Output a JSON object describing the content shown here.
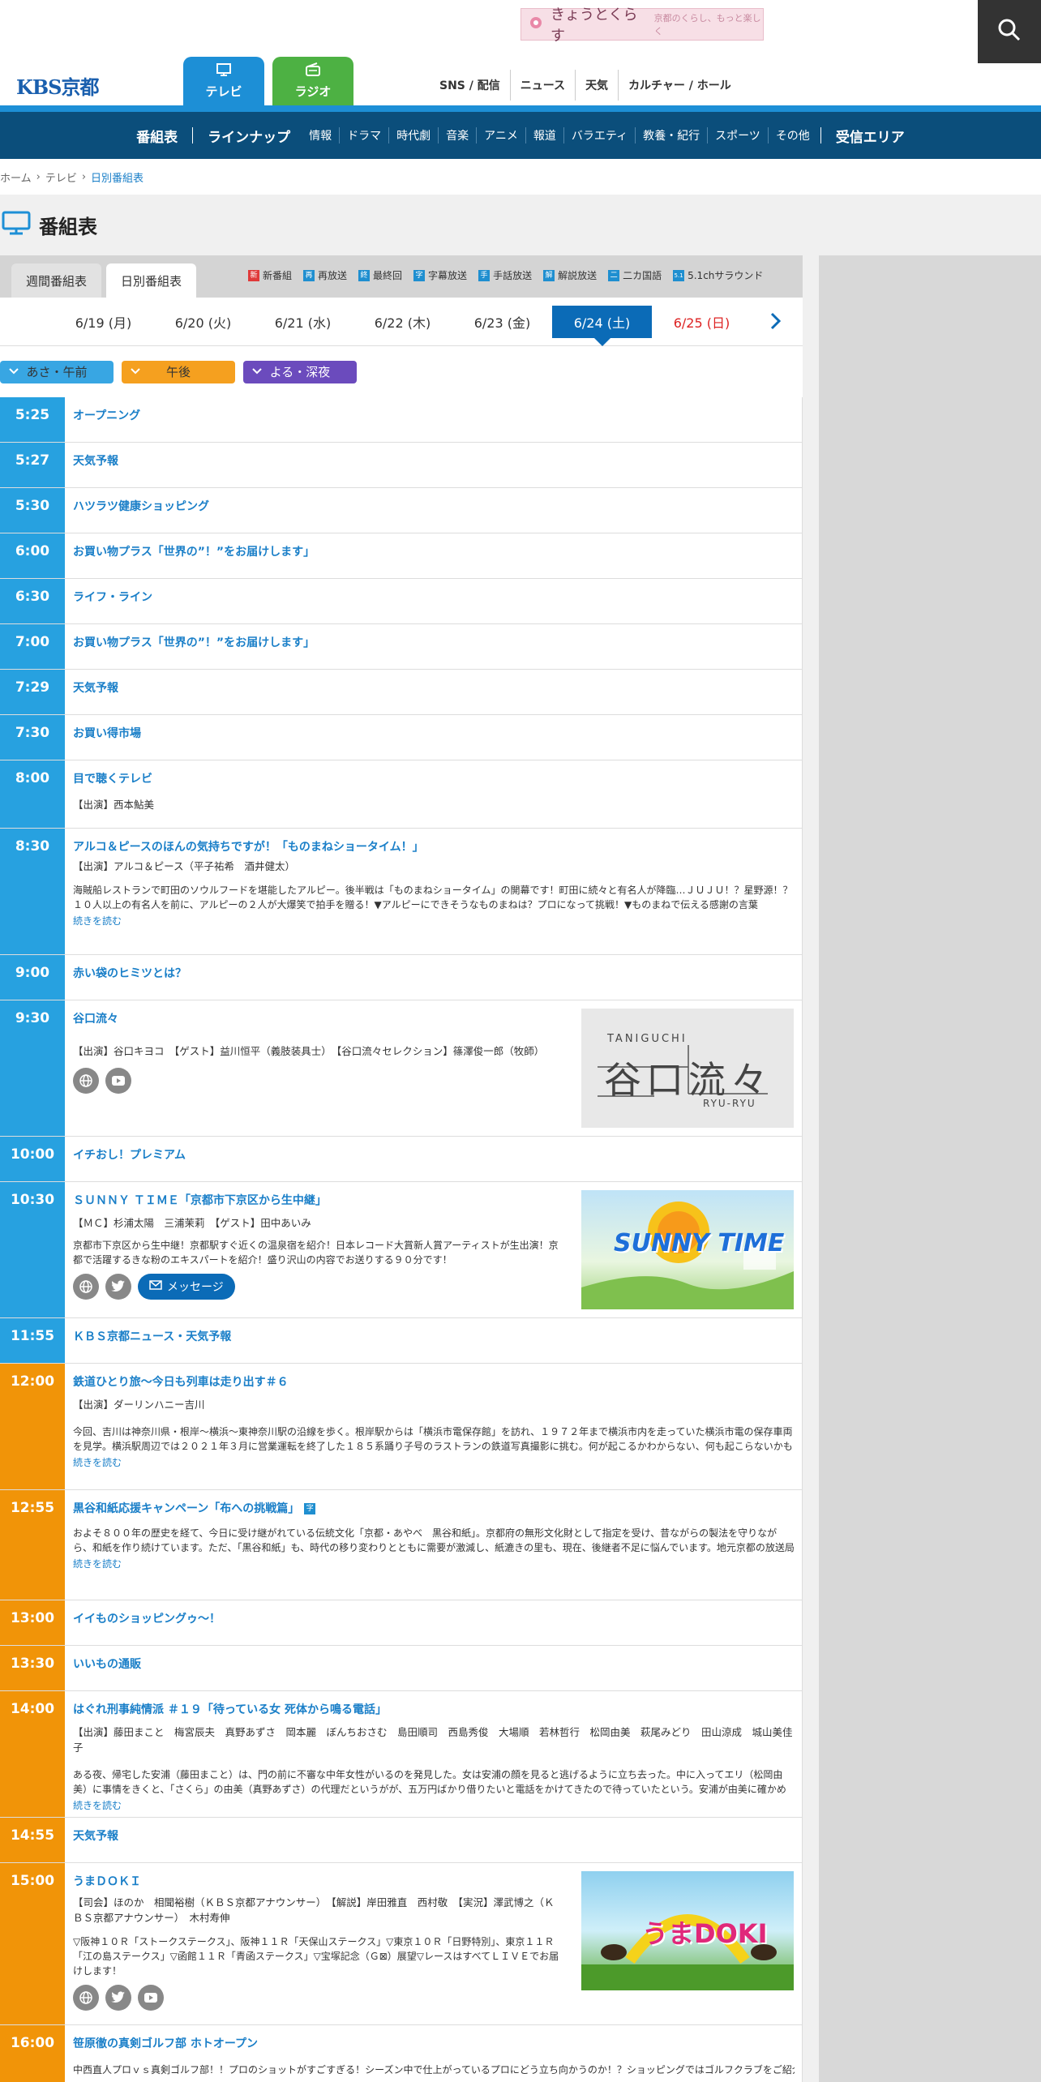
{
  "header": {
    "banner_title": "きょうとくらす",
    "banner_sub": "京都のくらし、もっと楽しく",
    "logo": "KBS京都",
    "tab_tv": "テレビ",
    "tab_radio": "ラジオ",
    "links": [
      "SNS / 配信",
      "ニュース",
      "天気",
      "カルチャー / ホール"
    ]
  },
  "nav": {
    "bangumi": "番組表",
    "lineup": "ラインナップ",
    "genres": [
      "情報",
      "ドラマ",
      "時代劇",
      "音楽",
      "アニメ",
      "報道",
      "バラエティ",
      "教養・紀行",
      "スポーツ",
      "その他"
    ],
    "area": "受信エリア"
  },
  "breadcrumb": [
    "ホーム",
    "テレビ",
    "日別番組表"
  ],
  "page_title": "番組表",
  "tabs": [
    "週間番組表",
    "日別番組表"
  ],
  "legend": [
    {
      "mark": "新",
      "label": "新番組",
      "color": "#e03a3a"
    },
    {
      "mark": "再",
      "label": "再放送",
      "color": "#1f8fd0"
    },
    {
      "mark": "終",
      "label": "最終回",
      "color": "#1f8fd0"
    },
    {
      "mark": "字",
      "label": "字幕放送",
      "color": "#1f8fd0"
    },
    {
      "mark": "手",
      "label": "手話放送",
      "color": "#1f8fd0"
    },
    {
      "mark": "解",
      "label": "解説放送",
      "color": "#1f8fd0"
    },
    {
      "mark": "二",
      "label": "二カ国語",
      "color": "#1f8fd0"
    },
    {
      "mark": "5.1",
      "label": "5.1chサラウンド",
      "color": "#1f8fd0"
    }
  ],
  "dates": [
    "6/19 (月)",
    "6/20 (火)",
    "6/21 (水)",
    "6/22 (木)",
    "6/23 (金)",
    "6/24 (土)",
    "6/25 (日)"
  ],
  "filters": [
    "あさ・午前",
    "午後",
    "よる・深夜"
  ],
  "programs": {
    "p0525": {
      "time": "5:25",
      "title": "オープニング"
    },
    "p0527": {
      "time": "5:27",
      "title": "天気予報"
    },
    "p0530": {
      "time": "5:30",
      "title": "ハツラツ健康ショッピング"
    },
    "p0600": {
      "time": "6:00",
      "title": "お買い物プラス「世界の”！”をお届けします」"
    },
    "p0630": {
      "time": "6:30",
      "title": "ライフ・ライン"
    },
    "p0700": {
      "time": "7:00",
      "title": "お買い物プラス「世界の”！”をお届けします」"
    },
    "p0729": {
      "time": "7:29",
      "title": "天気予報"
    },
    "p0730": {
      "time": "7:30",
      "title": "お買い得市場"
    },
    "p0800": {
      "time": "8:00",
      "title": "目で聴くテレビ",
      "cast": "【出演】西本鮎美"
    },
    "p0830": {
      "time": "8:30",
      "title": "アルコ＆ピースのほんの気持ちですが！「ものまねショータイム！」",
      "cast": "【出演】アルコ＆ピース（平子祐希　酒井健太）",
      "desc": "海賊船レストランで町田のソウルフードを堪能したアルピー。後半戦は「ものまねショータイム」の開幕です！町田に続々と有名人が降臨…ＪＵＪＵ！？星野源！？１０人以上の有名人を前に、アルピーの２人が大爆笑で拍手を贈る！▼アルピーにできそうなものまねは？プロになって挑戦！▼ものまねで伝える感謝の言葉",
      "more": "続きを読む"
    },
    "p0900": {
      "time": "9:00",
      "title": "赤い袋のヒミツとは？"
    },
    "p0930": {
      "time": "9:30",
      "title": "谷口流々",
      "cast": "【出演】谷口キヨコ　【ゲスト】益川恒平（義肢装具士）　【谷口流々セレクション】篠澤俊一郎（牧師）",
      "thumb_top": "TANIGUCHI",
      "thumb_main": "谷口流々",
      "thumb_sub": "RYU-RYU"
    },
    "p1000": {
      "time": "10:00",
      "title": "イチおし！プレミアム"
    },
    "p1030": {
      "time": "10:30",
      "title": "ＳＵＮＮＹ ＴＩＭＥ「京都市下京区から生中継」",
      "cast": "【ＭＣ】杉浦太陽　三浦茉莉　【ゲスト】田中あいみ",
      "desc": "京都市下京区から生中継！京都駅すぐ近くの温泉宿を紹介！日本レコード大賞新人賞アーティストが生出演！京都で活躍するきな粉のエキスパートを紹介！盛り沢山の内容でお送りする９０分です！",
      "msg": "メッセージ",
      "thumb_main": "SUNNY TIME"
    },
    "p1155": {
      "time": "11:55",
      "title": "ＫＢＳ京都ニュース・天気予報"
    },
    "p1200": {
      "time": "12:00",
      "title": "鉄道ひとり旅～今日も列車は走り出す＃６",
      "cast": "【出演】ダーリンハニー吉川",
      "desc": "今回、吉川は神奈川県・根岸～横浜～東神奈川駅の沿線を歩く。根岸駅からは「横浜市電保存館」を訪れ、１９７２年まで横浜市内を走っていた横浜市電の保存車両を見学。横浜駅周辺では２０２１年３月に営業運転を終了した１８５系踊り子号のラストランの鉄道写真撮影に挑む。何が起こるかわからない、何も起こらないかもしれない旅",
      "more": "続きを読む"
    },
    "p1255": {
      "time": "12:55",
      "title": "黒谷和紙応援キャンペーン「布への挑戦篇」",
      "desc": "およそ８００年の歴史を経て、今日に受け継がれている伝統文化「京都・あやべ　黒谷和紙」。京都府の無形文化財として指定を受け、昔ながらの製法を守りながら、和紙を作り続けています。ただ、「黒谷和紙」も、時代の移り変わりとともに需要が激減し、紙漉きの里も、現在、後継者不足に悩んでいます。地元京都の放送局として",
      "more": "続きを読む",
      "mark": "字"
    },
    "p1300": {
      "time": "13:00",
      "title": "イイものショッピングゥ～！"
    },
    "p1330": {
      "time": "13:30",
      "title": "いいもの通販"
    },
    "p1400": {
      "time": "14:00",
      "title": "はぐれ刑事純情派 ＃１９「待っている女 死体から鳴る電話」",
      "cast": "【出演】藤田まこと　梅宮辰夫　真野あずさ　岡本麗　ぼんちおさむ　島田順司　西島秀俊　大場順　若林哲行　松岡由美　萩尾みどり　田山涼成　城山美佳子",
      "desc": "ある夜、帰宅した安浦（藤田まこと）は、門の前に不審な中年女性がいるのを発見した。女は安浦の顔を見ると逃げるように立ち去った。中に入ってエリ（松岡由美）に事情をきくと、「さくら」の由美（真野あずさ）の代理だというがが、五万円ばかり借りたいと電話をかけてきたので待っていたという。安浦が由美に確かめると",
      "more": "続きを読む"
    },
    "p1455": {
      "time": "14:55",
      "title": "天気予報"
    },
    "p1500": {
      "time": "15:00",
      "title": "うまＤＯＫＩ",
      "cast": "【司会】ほのか　相聞裕樹（ＫＢＳ京都アナウンサー）　【解説】岸田雅直　西村敬　【実況】澤武博之（ＫＢＳ京都アナウンサー）　木村寿伸",
      "desc": "▽阪神１０Ｒ「ストークステークス」、阪神１１Ｒ「天保山ステークス」▽東京１０Ｒ「日野特別」、東京１１Ｒ「江の島ステークス」▽函館１１Ｒ「青函ステークス」▽宝塚記念（Ｇ⊠）展望▽レースはすべてＬＩＶＥでお届けします！",
      "thumb_main": "うまDOKI"
    },
    "p1600": {
      "time": "16:00",
      "title": "笹原徹の真剣ゴルフ部 ホトオープン",
      "desc": "中西直人プロｖｓ真剣ゴルフ部！！プロのショットがすごすぎる！シーズン中で仕上がっているプロにどう立ち向かうのか！？ショッピングではゴルフクラブをご紹介！"
    }
  }
}
